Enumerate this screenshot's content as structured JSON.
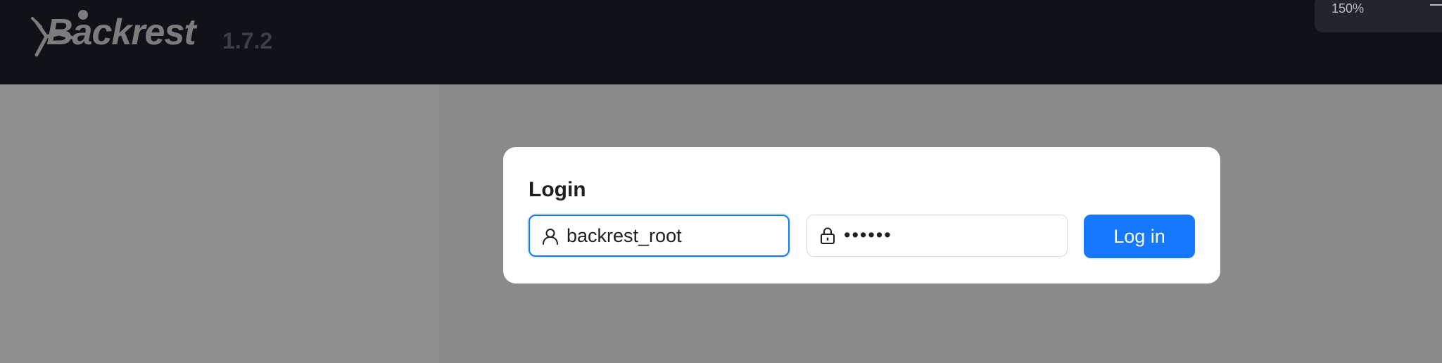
{
  "header": {
    "app_name": "Backrest",
    "version": "1.7.2",
    "logo_icon": "backrest-logo-icon"
  },
  "browser": {
    "zoom_level": "150%",
    "zoom_out_icon": "minus-icon"
  },
  "login": {
    "title": "Login",
    "username_value": "backrest_root",
    "username_icon": "user-icon",
    "password_value": "••••••",
    "password_icon": "lock-icon",
    "submit_label": "Log in"
  },
  "colors": {
    "header_bg": "#101217",
    "primary": "#1677ff",
    "overlay": "#8a8a8a"
  }
}
